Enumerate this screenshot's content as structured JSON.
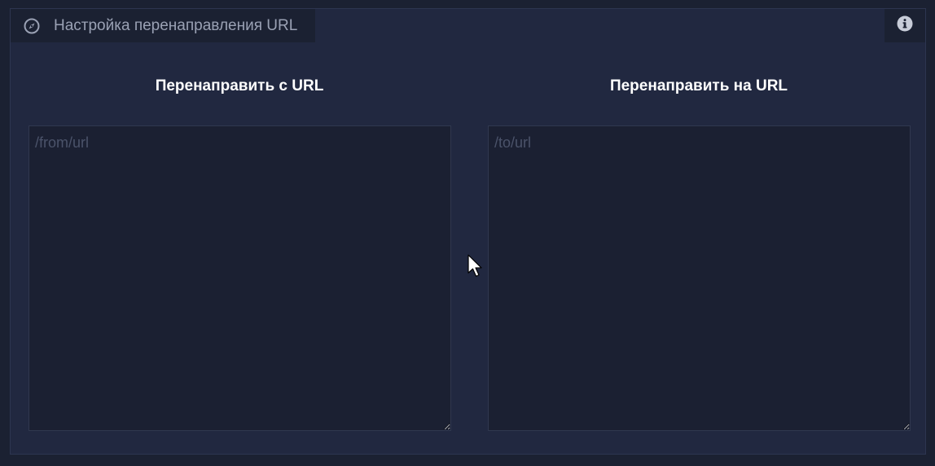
{
  "header": {
    "title": "Настройка перенаправления URL",
    "icon": "compass-icon",
    "info_icon": "info-icon"
  },
  "from": {
    "label": "Перенаправить с URL",
    "placeholder": "/from/url",
    "value": ""
  },
  "to": {
    "label": "Перенаправить на URL",
    "placeholder": "/to/url",
    "value": ""
  },
  "colors": {
    "page_bg": "#1b2132",
    "panel_bg": "#212840",
    "field_bg": "#1b2032",
    "title_text": "#9aa1b4",
    "label_text": "#ffffff",
    "placeholder_text": "#4b536a"
  }
}
